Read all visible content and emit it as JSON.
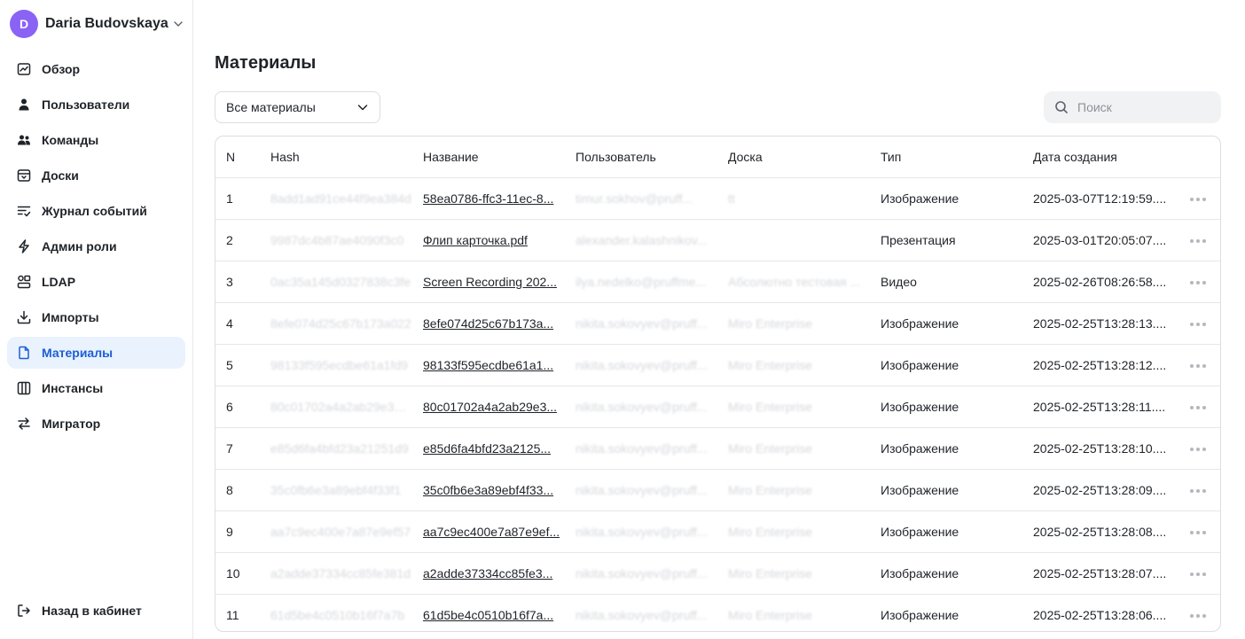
{
  "account": {
    "initial": "D",
    "name": "Daria Budovskaya",
    "avatar_color": "#8a63f5"
  },
  "sidebar": {
    "items": [
      {
        "label": "Обзор",
        "icon": "chart-icon"
      },
      {
        "label": "Пользователи",
        "icon": "user-icon"
      },
      {
        "label": "Команды",
        "icon": "team-icon"
      },
      {
        "label": "Доски",
        "icon": "board-icon"
      },
      {
        "label": "Журнал событий",
        "icon": "list-check-icon"
      },
      {
        "label": "Админ роли",
        "icon": "bolt-icon"
      },
      {
        "label": "LDAP",
        "icon": "ldap-icon"
      },
      {
        "label": "Импорты",
        "icon": "import-icon"
      },
      {
        "label": "Материалы",
        "icon": "file-icon",
        "active": true
      },
      {
        "label": "Инстансы",
        "icon": "columns-icon"
      },
      {
        "label": "Мигратор",
        "icon": "swap-icon"
      }
    ],
    "bottom": {
      "label": "Назад в кабинет",
      "icon": "exit-icon"
    },
    "active_color": "#1a5fd6",
    "active_bg": "#eaf2fe"
  },
  "main": {
    "title": "Материалы",
    "filter": {
      "selected": "Все материалы"
    },
    "search": {
      "placeholder": "Поиск"
    },
    "table": {
      "columns": [
        "N",
        "Hash",
        "Название",
        "Пользователь",
        "Доска",
        "Тип",
        "Дата создания"
      ],
      "rows": [
        {
          "n": "1",
          "hash": "8add1ad91ce44f9ea384d",
          "name": "58ea0786-ffc3-11ec-8...",
          "user": "timur.sokhov@pruff...",
          "board": "tt",
          "type": "Изображение",
          "date": "2025-03-07T12:19:59...."
        },
        {
          "n": "2",
          "hash": "9987dc4b87ae4090f3c0",
          "name": "Флип карточка.pdf",
          "user": "alexander.kalashnikov...",
          "board": "",
          "type": "Презентация",
          "date": "2025-03-01T20:05:07...."
        },
        {
          "n": "3",
          "hash": "0ac35a145d0327838c3fe",
          "name": "Screen Recording 202...",
          "user": "ilya.nedelko@pruffme...",
          "board": "Абсолютно тестовая ...",
          "type": "Видео",
          "date": "2025-02-26T08:26:58...."
        },
        {
          "n": "4",
          "hash": "8efe074d25c67b173a022",
          "name": "8efe074d25c67b173a...",
          "user": "nikita.sokovyev@pruff...",
          "board": "Miro Enterprise",
          "type": "Изображение",
          "date": "2025-02-25T13:28:13...."
        },
        {
          "n": "5",
          "hash": "98133f595ecdbe61a1fd9",
          "name": "98133f595ecdbe61a1...",
          "user": "nikita.sokovyev@pruff...",
          "board": "Miro Enterprise",
          "type": "Изображение",
          "date": "2025-02-25T13:28:12...."
        },
        {
          "n": "6",
          "hash": "80c01702a4a2ab29e34bc",
          "name": "80c01702a4a2ab29e3...",
          "user": "nikita.sokovyev@pruff...",
          "board": "Miro Enterprise",
          "type": "Изображение",
          "date": "2025-02-25T13:28:11...."
        },
        {
          "n": "7",
          "hash": "e85d6fa4bfd23a21251d9",
          "name": "e85d6fa4bfd23a2125...",
          "user": "nikita.sokovyev@pruff...",
          "board": "Miro Enterprise",
          "type": "Изображение",
          "date": "2025-02-25T13:28:10...."
        },
        {
          "n": "8",
          "hash": "35c0fb6e3a89ebf4f33f1",
          "name": "35c0fb6e3a89ebf4f33...",
          "user": "nikita.sokovyev@pruff...",
          "board": "Miro Enterprise",
          "type": "Изображение",
          "date": "2025-02-25T13:28:09...."
        },
        {
          "n": "9",
          "hash": "aa7c9ec400e7a87e9ef57",
          "name": "aa7c9ec400e7a87e9ef...",
          "user": "nikita.sokovyev@pruff...",
          "board": "Miro Enterprise",
          "type": "Изображение",
          "date": "2025-02-25T13:28:08...."
        },
        {
          "n": "10",
          "hash": "a2adde37334cc85fe381d",
          "name": "a2adde37334cc85fe3...",
          "user": "nikita.sokovyev@pruff...",
          "board": "Miro Enterprise",
          "type": "Изображение",
          "date": "2025-02-25T13:28:07...."
        },
        {
          "n": "11",
          "hash": "61d5be4c0510b16f7a7b",
          "name": "61d5be4c0510b16f7a...",
          "user": "nikita.sokovyev@pruff...",
          "board": "Miro Enterprise",
          "type": "Изображение",
          "date": "2025-02-25T13:28:06...."
        }
      ]
    }
  }
}
